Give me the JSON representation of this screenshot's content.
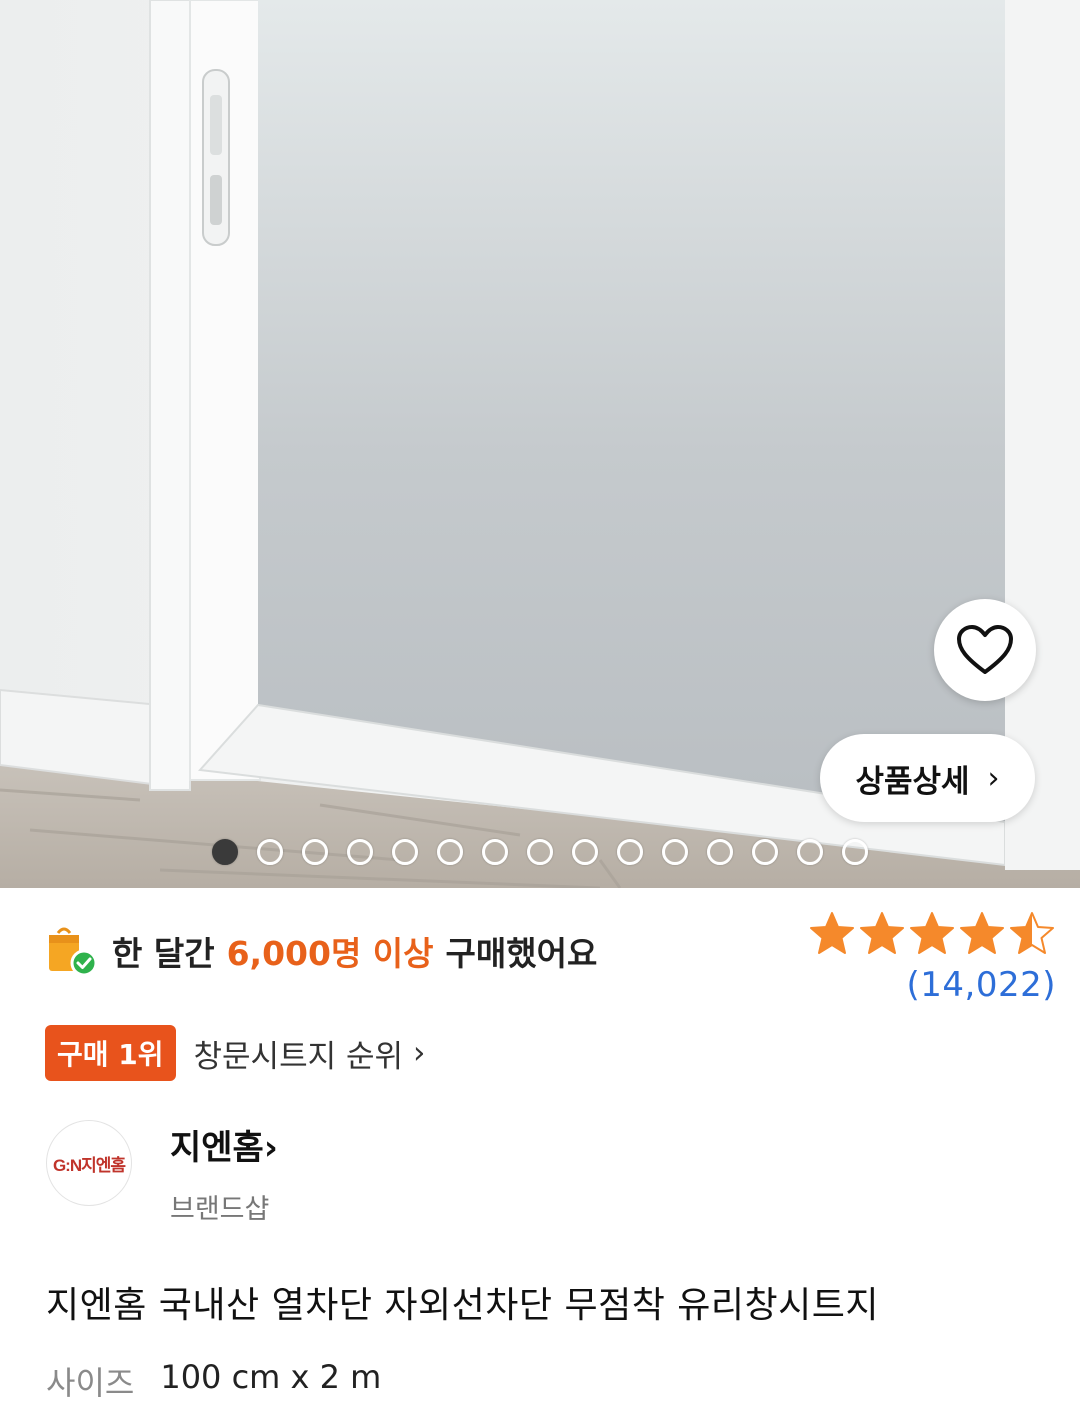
{
  "hero": {
    "favorite_icon": "heart-outline-icon",
    "detail_button_label": "상품상세",
    "detail_chevron": "›",
    "image_count": 15,
    "active_image_index": 0
  },
  "purchase": {
    "prefix": "한 달간",
    "highlight": "6,000명 이상",
    "suffix": "구매했어요",
    "icon": "shopping-bag-check-icon",
    "highlight_color": "#e8611a"
  },
  "rating": {
    "value": 4.5,
    "max": 5,
    "review_count": "(14,022)",
    "star_color": "#f5892b"
  },
  "rank": {
    "badge": "구매 1위",
    "category_link": "창문시트지 순위",
    "chevron": "›"
  },
  "brand": {
    "logo_text": "G:N지엔홈",
    "name": "지엔홈",
    "chevron": "›",
    "subtitle": "브랜드샵"
  },
  "product": {
    "title": "지엔홈 국내산 열차단 자외선차단 무점착 유리창시트지",
    "option_label": "사이즈",
    "option_value": "100 cm x 2 m"
  }
}
